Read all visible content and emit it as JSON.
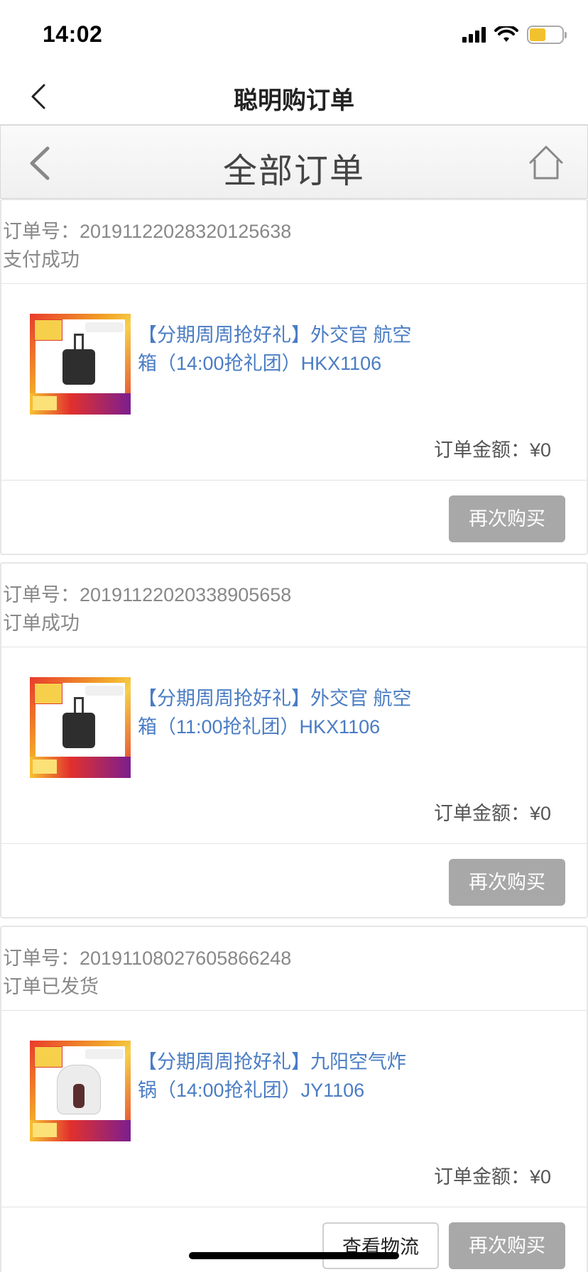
{
  "status_bar": {
    "time": "14:02",
    "icons": [
      "signal-icon",
      "wifi-icon",
      "battery-icon"
    ]
  },
  "navbar": {
    "title": "聪明购订单",
    "back_icon": "chevron-left-icon"
  },
  "subheader": {
    "title": "全部订单",
    "back_icon": "chevron-left-icon",
    "home_icon": "home-icon"
  },
  "orders": [
    {
      "order_no": "订单号：20191122028320125638",
      "status": "支付成功",
      "product_title": "【分期周周抢好礼】外交官 航空箱（14:00抢礼团）HKX1106",
      "product_image": "suitcase",
      "amount": "订单金额：¥0",
      "rebuy_label": "再次购买"
    },
    {
      "order_no": "订单号：20191122020338905658",
      "status": "订单成功",
      "product_title": "【分期周周抢好礼】外交官 航空箱（11:00抢礼团）HKX1106",
      "product_image": "suitcase",
      "amount": "订单金额：¥0",
      "rebuy_label": "再次购买"
    },
    {
      "order_no": "订单号：20191108027605866248",
      "status": "订单已发货",
      "product_title": "【分期周周抢好礼】九阳空气炸锅（14:00抢礼团）JY1106",
      "product_image": "air-fryer",
      "amount": "订单金额：¥0",
      "track_label": "查看物流",
      "rebuy_label": "再次购买"
    }
  ],
  "colors": {
    "link_blue": "#4a7cc4",
    "button_gray": "#a8a8a8",
    "battery_yellow": "#f2c12e"
  }
}
